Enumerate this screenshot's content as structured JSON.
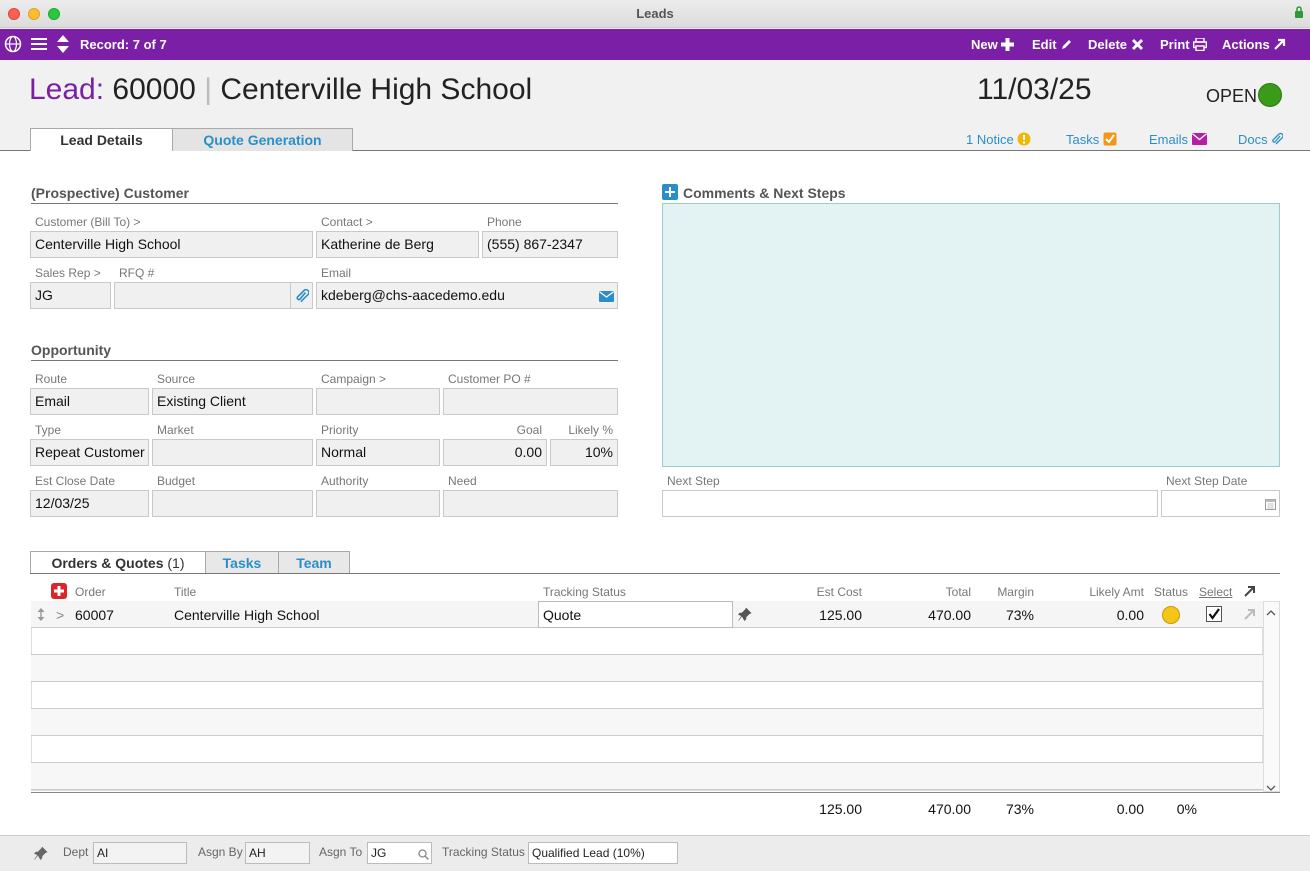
{
  "window": {
    "title": "Leads"
  },
  "toolbar": {
    "record_label": "Record: 7 of 7",
    "new_label": "New",
    "edit_label": "Edit",
    "delete_label": "Delete",
    "print_label": "Print",
    "actions_label": "Actions",
    "accent_color": "#7a1fa6"
  },
  "header": {
    "lead_label": "Lead:",
    "lead_number": "60000",
    "separator": "|",
    "customer_name": "Centerville High School",
    "date": "11/03/25",
    "status": "OPEN",
    "status_color": "#3a9a1a"
  },
  "tabs": [
    {
      "label": "Lead Details",
      "active": true
    },
    {
      "label": "Quote Generation",
      "active": false
    }
  ],
  "header_links": {
    "notice": "1 Notice",
    "tasks": "Tasks",
    "emails": "Emails",
    "docs": "Docs"
  },
  "customer_section": {
    "title": "(Prospective) Customer",
    "customer_label": "Customer (Bill To) >",
    "customer_value": "Centerville High School",
    "contact_label": "Contact >",
    "contact_value": "Katherine de Berg",
    "phone_label": "Phone",
    "phone_value": "(555) 867-2347",
    "salesrep_label": "Sales Rep >",
    "salesrep_value": "JG",
    "rfq_label": "RFQ #",
    "rfq_value": "",
    "email_label": "Email",
    "email_value": "kdeberg@chs-aacedemo.edu"
  },
  "opportunity_section": {
    "title": "Opportunity",
    "route_label": "Route",
    "route_value": "Email",
    "source_label": "Source",
    "source_value": "Existing Client",
    "campaign_label": "Campaign >",
    "campaign_value": "",
    "customer_po_label": "Customer PO #",
    "customer_po_value": "",
    "type_label": "Type",
    "type_value": "Repeat Customer",
    "market_label": "Market",
    "market_value": "",
    "priority_label": "Priority",
    "priority_value": "Normal",
    "goal_label": "Goal",
    "goal_value": "0.00",
    "likely_label": "Likely %",
    "likely_value": "10%",
    "est_close_label": "Est Close Date",
    "est_close_value": "12/03/25",
    "budget_label": "Budget",
    "budget_value": "",
    "authority_label": "Authority",
    "authority_value": "",
    "need_label": "Need",
    "need_value": ""
  },
  "comments_section": {
    "title": "Comments & Next Steps",
    "comments_value": "",
    "next_step_label": "Next Step",
    "next_step_value": "",
    "next_step_date_label": "Next Step Date",
    "next_step_date_value": ""
  },
  "grid_tabs": {
    "orders_label": "Orders & Quotes",
    "orders_count": "(1)",
    "tasks_label": "Tasks",
    "team_label": "Team"
  },
  "grid": {
    "columns": {
      "order": "Order",
      "title": "Title",
      "tracking_status": "Tracking Status",
      "est_cost": "Est Cost",
      "total": "Total",
      "margin": "Margin",
      "likely_amt": "Likely Amt",
      "status": "Status",
      "select": "Select"
    },
    "row": {
      "expander": ">",
      "order": "60007",
      "title": "Centerville High School",
      "tracking_status": "Quote",
      "est_cost": "125.00",
      "total": "470.00",
      "margin": "73%",
      "likely_amt": "0.00",
      "status_color": "#f5c518",
      "selected": true
    },
    "totals": {
      "est_cost": "125.00",
      "total": "470.00",
      "margin": "73%",
      "likely_amt": "0.00",
      "select_pct": "0%"
    }
  },
  "footer": {
    "dept_label": "Dept",
    "dept_value": "AI",
    "asgn_by_label": "Asgn By",
    "asgn_by_value": "AH",
    "asgn_to_label": "Asgn To",
    "asgn_to_value": "JG",
    "tracking_label": "Tracking Status",
    "tracking_value": "Qualified Lead (10%)"
  }
}
